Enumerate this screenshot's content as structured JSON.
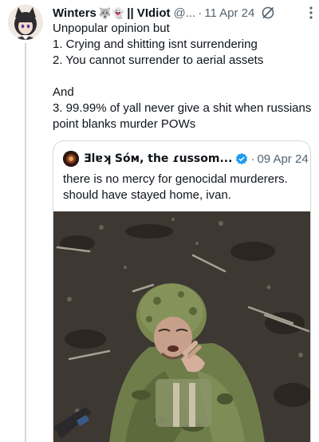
{
  "post": {
    "display_name": "Winters",
    "name_emojis": "🐺👻",
    "name_suffix": "|| VIdiot",
    "handle": "@...",
    "separator": "·",
    "date": "11 Apr 24",
    "text": "Unpopular opinion but\n1. Crying and shitting isnt surrendering\n2. You cannot surrender to aerial assets\n\nAnd\n3. 99.99% of yall never give a shit when russians point blanks murder POWs",
    "icons": [
      "avatar",
      "grok-icon",
      "more-icon"
    ]
  },
  "quote": {
    "display_name": "Ǝlɐʞ Sóᴍ, the ɾussom...",
    "separator": "·",
    "date": "09 Apr 24",
    "text": "there is no mercy for genocidal murderers.\nshould have stayed home, ivan.",
    "icons": [
      "quote-avatar",
      "verified-badge-icon"
    ],
    "media": "photo of a soldier in camouflage helmet lying on dirt ground"
  },
  "colors": {
    "text": "#0f1419",
    "secondary": "#536471",
    "border": "#cfd9de",
    "verified": "#1d9bf0"
  }
}
